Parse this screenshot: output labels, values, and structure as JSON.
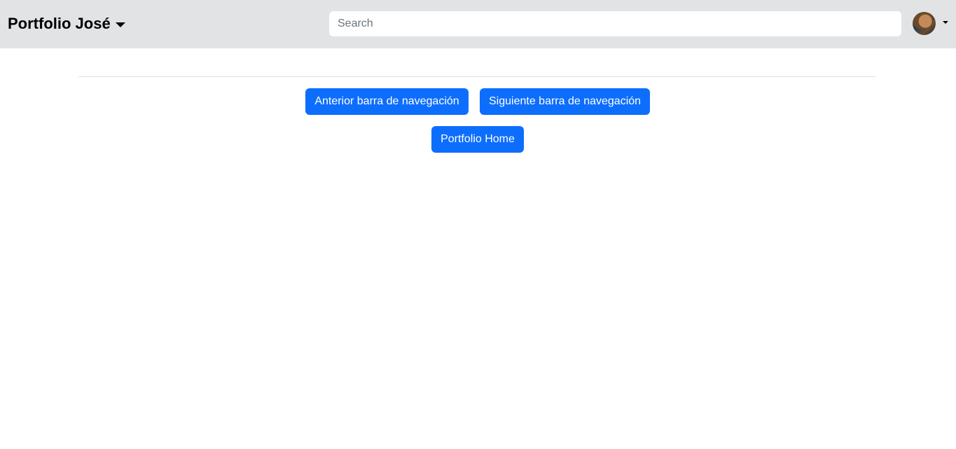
{
  "navbar": {
    "brand": "Portfolio José",
    "search_placeholder": "Search",
    "search_value": ""
  },
  "buttons": {
    "prev_label": "Anterior barra de navegación",
    "next_label": "Siguiente barra de navegación",
    "home_label": "Portfolio Home"
  },
  "colors": {
    "navbar_bg": "#e2e3e5",
    "primary": "#0d6efd"
  }
}
